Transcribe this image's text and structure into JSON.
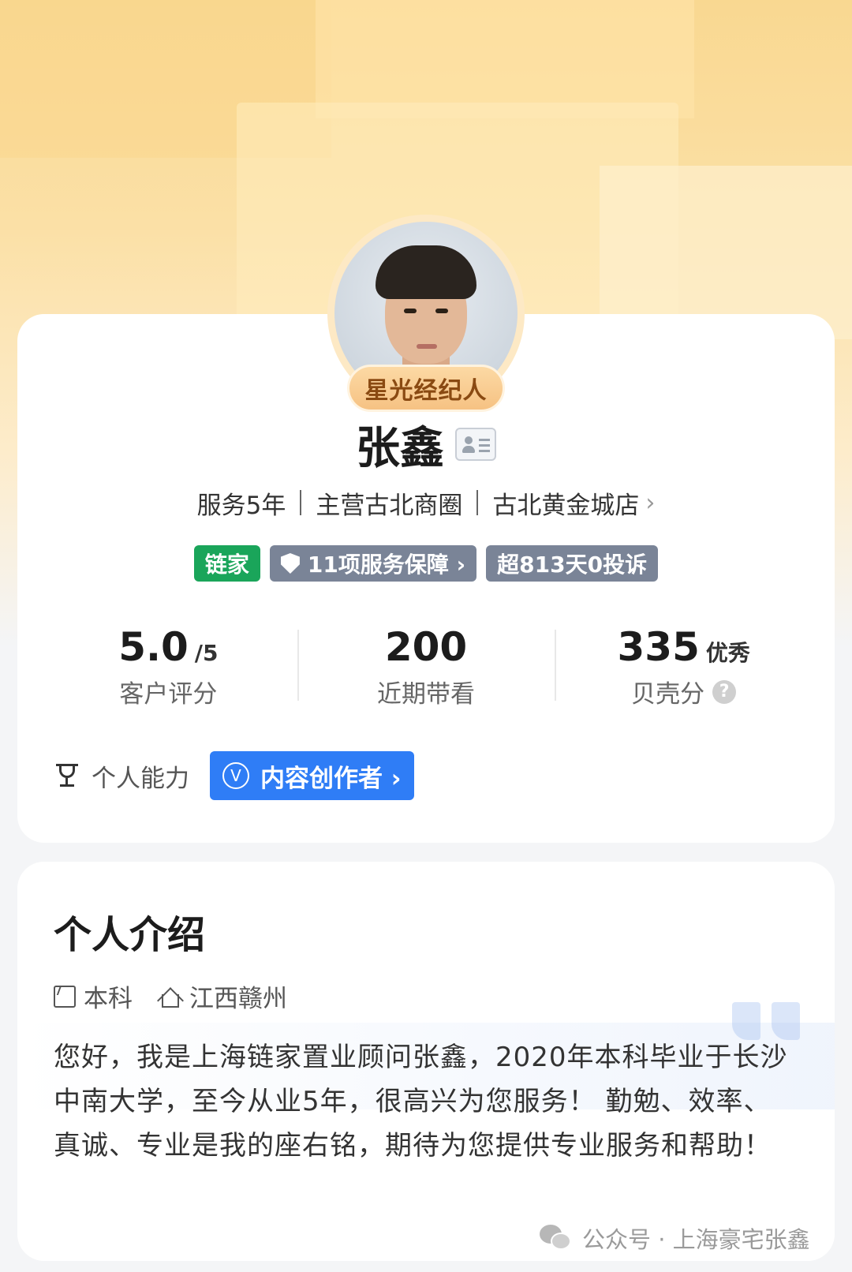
{
  "profile": {
    "badge": "星光经纪人",
    "name": "张鑫",
    "meta": {
      "years": "服务5年",
      "area": "主营古北商圈",
      "store": "古北黄金城店",
      "store_chevron": "›"
    },
    "tags": {
      "brand": "链家",
      "guarantee": "11项服务保障 ›",
      "no_complaint": "超813天0投诉"
    },
    "stats": [
      {
        "value": "5.0",
        "suffix": "/5",
        "label": "客户评分"
      },
      {
        "value": "200",
        "suffix": "",
        "label": "近期带看"
      },
      {
        "value": "335",
        "suffix": "优秀",
        "label": "贝壳分"
      }
    ],
    "help_icon": "?",
    "ability": {
      "label": "个人能力",
      "button_icon": "V",
      "button_label": "内容创作者 ›"
    }
  },
  "intro": {
    "title": "个人介绍",
    "education": "本科",
    "hometown": "江西赣州",
    "text": "您好，我是上海链家置业顾问张鑫，2020年本科毕业于长沙中南大学，至今从业5年，很高兴为您服务！ 勤勉、效率、真诚、专业是我的座右铭，期待为您提供专业服务和帮助！"
  },
  "watermark": "公众号 · 上海豪宅张鑫",
  "colors": {
    "brand_green": "#1aa55a",
    "tag_gray": "#7a8497",
    "creator_blue": "#2f7df6",
    "badge_gold": "#f6c283"
  },
  "icons": [
    "id-card-icon",
    "shield-icon",
    "trophy-icon",
    "v-icon",
    "book-icon",
    "house-icon",
    "quote-icon",
    "wechat-icon",
    "question-icon",
    "chevron-right-icon"
  ]
}
